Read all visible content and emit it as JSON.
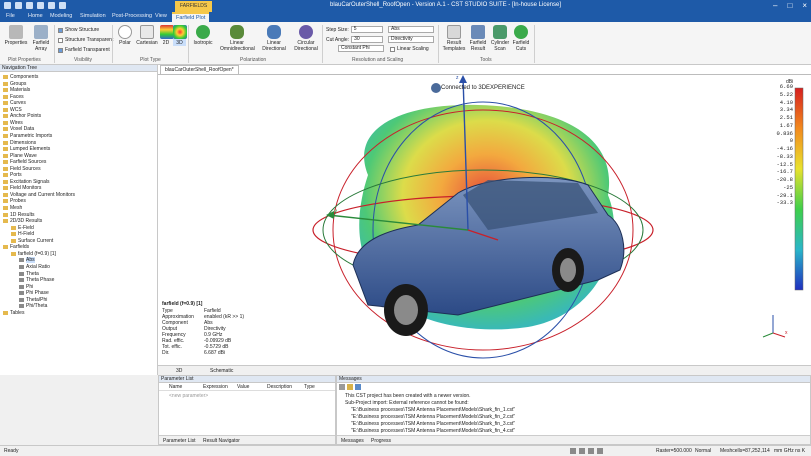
{
  "window": {
    "title": "blauCarOuterShell_RoofOpen - Version A.1 - CST STUDIO SUITE - [In-house License]",
    "context_tab": "FARFIELDS"
  },
  "menu_tabs": [
    "File",
    "Home",
    "Modeling",
    "Simulation",
    "Post-Processing",
    "View",
    "Farfield Plot"
  ],
  "ribbon": {
    "plot_properties": {
      "label": "Plot Properties",
      "btn1": "Properties",
      "btn2": "Farfield Array"
    },
    "visibility": {
      "label": "Visibility",
      "show_structure": "Show Structure",
      "structure_transparent": "Structure Transparent",
      "farfield_transparent": "Farfield Transparent"
    },
    "plot_type": {
      "label": "Plot Type",
      "polar": "Polar",
      "cartesian": "Cartesian",
      "p2d": "2D",
      "p3d": "3D"
    },
    "polarization": {
      "label": "Polarization",
      "isotropic": "Isotropic",
      "linear_omni": "Linear Omnidirectional",
      "linear_dir": "Linear Directional",
      "circular_dir": "Circular Directional"
    },
    "resolution": {
      "label": "Resolution and Scaling",
      "step_size_label": "Step Size:",
      "step_size": "5",
      "cut_angle_label": "Cut Angle:",
      "cut_angle": "30",
      "constant_phi": "Constant Phi",
      "abs": "Abs",
      "directivity": "Directivity",
      "linear_scaling": "Linear Scaling"
    },
    "tools": {
      "label": "Tools",
      "result_templates": "Result Templates",
      "farfield_result": "Farfield Result",
      "cylinder_scan": "Cylinder Scan",
      "farfield_cuts": "Farfield Cuts"
    }
  },
  "nav_tree": {
    "title": "Navigation Tree",
    "items": [
      {
        "label": "Components",
        "indent": 0,
        "type": "folder"
      },
      {
        "label": "Groups",
        "indent": 0,
        "type": "folder"
      },
      {
        "label": "Materials",
        "indent": 0,
        "type": "folder"
      },
      {
        "label": "Faces",
        "indent": 0,
        "type": "folder"
      },
      {
        "label": "Curves",
        "indent": 0,
        "type": "folder"
      },
      {
        "label": "WCS",
        "indent": 0,
        "type": "folder"
      },
      {
        "label": "Anchor Points",
        "indent": 0,
        "type": "folder"
      },
      {
        "label": "Wires",
        "indent": 0,
        "type": "folder"
      },
      {
        "label": "Voxel Data",
        "indent": 0,
        "type": "folder"
      },
      {
        "label": "Parametric Imports",
        "indent": 0,
        "type": "folder"
      },
      {
        "label": "Dimensions",
        "indent": 0,
        "type": "folder"
      },
      {
        "label": "Lumped Elements",
        "indent": 0,
        "type": "folder"
      },
      {
        "label": "Plane Wave",
        "indent": 0,
        "type": "folder"
      },
      {
        "label": "Farfield Sources",
        "indent": 0,
        "type": "folder"
      },
      {
        "label": "Field Sources",
        "indent": 0,
        "type": "folder"
      },
      {
        "label": "Ports",
        "indent": 0,
        "type": "folder"
      },
      {
        "label": "Excitation Signals",
        "indent": 0,
        "type": "folder"
      },
      {
        "label": "Field Monitors",
        "indent": 0,
        "type": "folder"
      },
      {
        "label": "Voltage and Current Monitors",
        "indent": 0,
        "type": "folder"
      },
      {
        "label": "Probes",
        "indent": 0,
        "type": "folder"
      },
      {
        "label": "Mesh",
        "indent": 0,
        "type": "folder"
      },
      {
        "label": "1D Results",
        "indent": 0,
        "type": "folder"
      },
      {
        "label": "2D/3D Results",
        "indent": 0,
        "type": "folder"
      },
      {
        "label": "E-Field",
        "indent": 1,
        "type": "folder"
      },
      {
        "label": "H-Field",
        "indent": 1,
        "type": "folder"
      },
      {
        "label": "Surface Current",
        "indent": 1,
        "type": "folder"
      },
      {
        "label": "Farfields",
        "indent": 0,
        "type": "folder"
      },
      {
        "label": "farfield (f=0.9) [1]",
        "indent": 1,
        "type": "folder"
      },
      {
        "label": "Abs",
        "indent": 2,
        "type": "leaf",
        "selected": true
      },
      {
        "label": "Axial Ratio",
        "indent": 2,
        "type": "leaf"
      },
      {
        "label": "Theta",
        "indent": 2,
        "type": "leaf"
      },
      {
        "label": "Theta Phase",
        "indent": 2,
        "type": "leaf"
      },
      {
        "label": "Phi",
        "indent": 2,
        "type": "leaf"
      },
      {
        "label": "Phi Phase",
        "indent": 2,
        "type": "leaf"
      },
      {
        "label": "Theta/Phi",
        "indent": 2,
        "type": "leaf"
      },
      {
        "label": "Phi/Theta",
        "indent": 2,
        "type": "leaf"
      },
      {
        "label": "Tables",
        "indent": 0,
        "type": "folder"
      }
    ]
  },
  "viewport": {
    "tab": "blauCarOuterShell_RoofOpen*",
    "connected": "Connected to 3DEXPERIENCE",
    "axis_x": "x",
    "axis_y": "y",
    "axis_z": "z",
    "scale_unit": "dBi",
    "scale_values": [
      "6.69",
      "5.22",
      "4.10",
      "3.34",
      "2.51",
      "1.67",
      "0.836",
      "0",
      "-4.16",
      "-8.33",
      "-12.5",
      "-16.7",
      "-20.8",
      "-25",
      "-29.1",
      "-33.3"
    ],
    "info_title": "farfield (f=0.9) [1]",
    "info": [
      {
        "k": "Type",
        "v": "Farfield"
      },
      {
        "k": "Approximation",
        "v": "enabled (kR >> 1)"
      },
      {
        "k": "Component",
        "v": "Abs"
      },
      {
        "k": "Output",
        "v": "Directivity"
      },
      {
        "k": "Frequency",
        "v": "0.9 GHz"
      },
      {
        "k": "Rad. effic.",
        "v": "-0.09929 dB"
      },
      {
        "k": "Tot. effic.",
        "v": "-0.5729 dB"
      },
      {
        "k": "Dir.",
        "v": "6.687 dBi"
      }
    ],
    "bottom_tabs": [
      "3D",
      "Schematic"
    ]
  },
  "param_list": {
    "title": "Parameter List",
    "cols": [
      "Name",
      "Expression",
      "Value",
      "Description",
      "Type"
    ],
    "placeholder": "<new parameter>",
    "tabs": [
      "Parameter List",
      "Result Navigator"
    ]
  },
  "messages": {
    "title": "Messages",
    "lines": [
      "This CST project has been created with a newer version.",
      "Sub-Project import: External reference cannot be found:",
      "\"E:\\Business processes\\TSM Antenna Placement\\Models\\Shark_fin_1.cst\"",
      "\"E:\\Business processes\\TSM Antenna Placement\\Models\\Shark_fin_2.cst\"",
      "\"E:\\Business processes\\TSM Antenna Placement\\Models\\Shark_fin_3.cst\"",
      "\"E:\\Business processes\\TSM Antenna Placement\\Models\\Shark_fin_4.cst\""
    ],
    "tabs": [
      "Messages",
      "Progress"
    ]
  },
  "statusbar": {
    "ready": "Ready",
    "raster": "Raster=500.000",
    "normal": "Normal",
    "meshcells": "Meshcells=87,252,114",
    "units": "mm  GHz  ns  K"
  },
  "colors": {
    "brand_blue": "#1e5aa8",
    "context_yellow": "#f6c84a"
  }
}
